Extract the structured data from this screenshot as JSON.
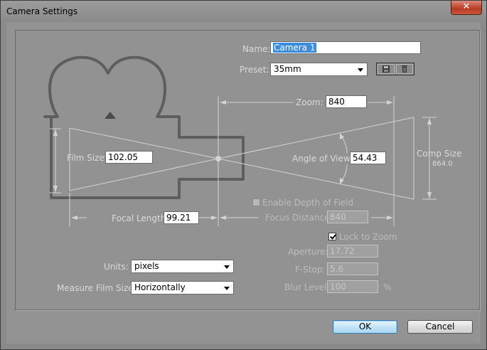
{
  "window": {
    "title": "Camera Settings",
    "close_glyph": "✕"
  },
  "name": {
    "label": "Name:",
    "value": "Camera 1"
  },
  "preset": {
    "label": "Preset:",
    "value": "35mm",
    "icons": [
      "save-preset-icon",
      "delete-preset-icon"
    ]
  },
  "zoom": {
    "label": "Zoom:",
    "value": "840"
  },
  "film_size": {
    "label": "Film Size:",
    "value": "102.05"
  },
  "angle_of_view": {
    "label": "Angle of View:",
    "value": "54.43"
  },
  "comp_size": {
    "label": "Comp Size",
    "value": "864.0"
  },
  "focal_length": {
    "label": "Focal Length:",
    "value": "99.21"
  },
  "depth_of_field": {
    "label": "Enable Depth of Field",
    "checked": false
  },
  "focus_distance": {
    "label": "Focus Distance:",
    "value": "840"
  },
  "lock_to_zoom": {
    "label": "Lock to Zoom",
    "checked": true
  },
  "aperture": {
    "label": "Aperture:",
    "value": "17.72"
  },
  "f_stop": {
    "label": "F-Stop:",
    "value": "5.6"
  },
  "blur_level": {
    "label": "Blur Level:",
    "value": "100",
    "unit": "%"
  },
  "units": {
    "label": "Units:",
    "value": "pixels"
  },
  "measure_film_size": {
    "label": "Measure Film Size:",
    "value": "Horizontally"
  },
  "buttons": {
    "ok": "OK",
    "cancel": "Cancel"
  },
  "colors": {
    "diagram_stroke": "#5e5e5e",
    "diagram_light": "#d4d4d4",
    "selection": "#3c8de0"
  }
}
